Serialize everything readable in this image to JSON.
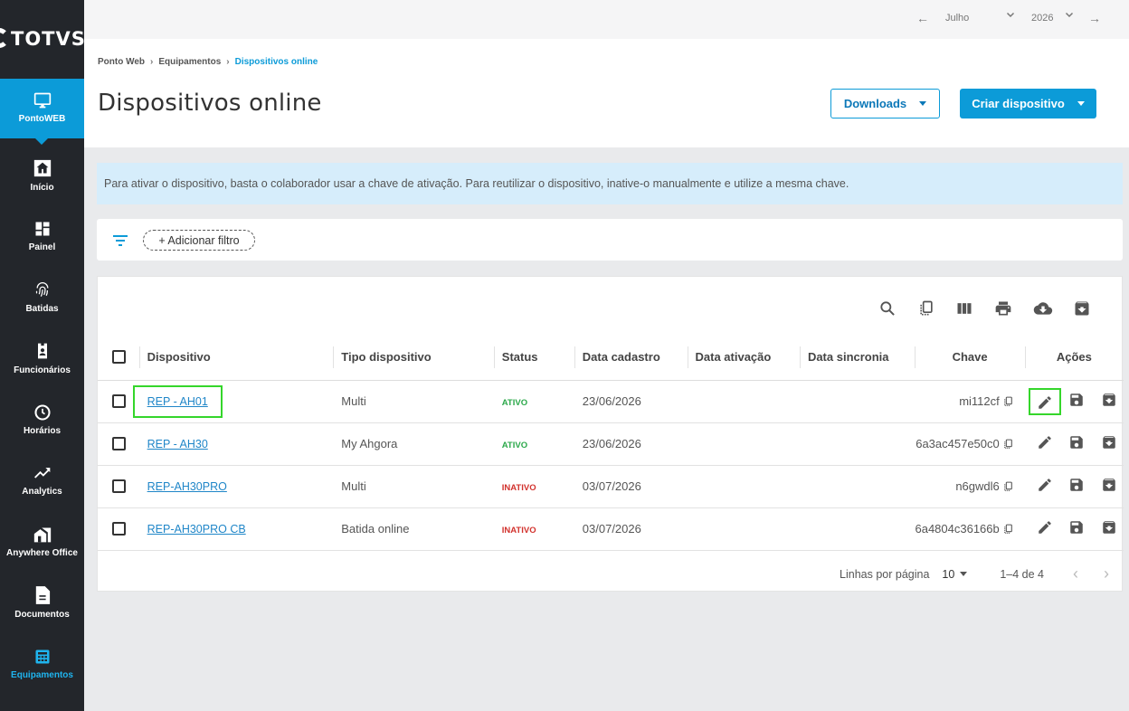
{
  "brand": {
    "name": "TOTVS"
  },
  "sidebar": {
    "items": [
      {
        "label": "PontoWEB",
        "icon": "monitor-icon",
        "active": true
      },
      {
        "label": "Início",
        "icon": "home-icon"
      },
      {
        "label": "Painel",
        "icon": "dashboard-icon"
      },
      {
        "label": "Batidas",
        "icon": "fingerprint-icon"
      },
      {
        "label": "Funcionários",
        "icon": "badge-icon"
      },
      {
        "label": "Horários",
        "icon": "clock-icon"
      },
      {
        "label": "Analytics",
        "icon": "trending-up-icon"
      },
      {
        "label": "Anywhere Office",
        "icon": "home-work-icon"
      },
      {
        "label": "Documentos",
        "icon": "document-icon"
      },
      {
        "label": "Equipamentos",
        "icon": "calculator-icon",
        "current": true
      }
    ]
  },
  "topbar": {
    "month": "Julho",
    "year": "2026"
  },
  "breadcrumb": {
    "items": [
      "Ponto Web",
      "Equipamentos",
      "Dispositivos online"
    ]
  },
  "page": {
    "title": "Dispositivos online"
  },
  "buttons": {
    "downloads": "Downloads",
    "create": "Criar dispositivo"
  },
  "banner": {
    "text": "Para ativar o dispositivo, basta o colaborador usar a chave de ativação. Para reutilizar o dispositivo, inative-o manualmente e utilize a mesma chave."
  },
  "filter": {
    "add_label": "+ Adicionar filtro"
  },
  "table": {
    "columns": [
      "Dispositivo",
      "Tipo dispositivo",
      "Status",
      "Data cadastro",
      "Data ativação",
      "Data sincronia",
      "Chave",
      "Ações"
    ],
    "rows": [
      {
        "device": "REP - AH01",
        "type": "Multi",
        "status": "ATIVO",
        "created": "23/06/2026",
        "activated": "",
        "synced": "",
        "key": "mi112cf"
      },
      {
        "device": "REP - AH30",
        "type": "My Ahgora",
        "status": "ATIVO",
        "created": "23/06/2026",
        "activated": "",
        "synced": "",
        "key": "6a3ac457e50c0"
      },
      {
        "device": "REP-AH30PRO",
        "type": "Multi",
        "status": "INATIVO",
        "created": "03/07/2026",
        "activated": "",
        "synced": "",
        "key": "n6gwdl6"
      },
      {
        "device": "REP-AH30PRO CB",
        "type": "Batida online",
        "status": "INATIVO",
        "created": "03/07/2026",
        "activated": "",
        "synced": "",
        "key": "6a4804c36166b"
      }
    ]
  },
  "pagination": {
    "rows_per_page_label": "Linhas por página",
    "rows_per_page": "10",
    "range": "1–4 de 4"
  },
  "colors": {
    "accent": "#0c9bd8",
    "sidebar": "#23262b",
    "active_status": "#2ba84a",
    "inactive_status": "#d2322d",
    "highlight": "#35d62b"
  }
}
